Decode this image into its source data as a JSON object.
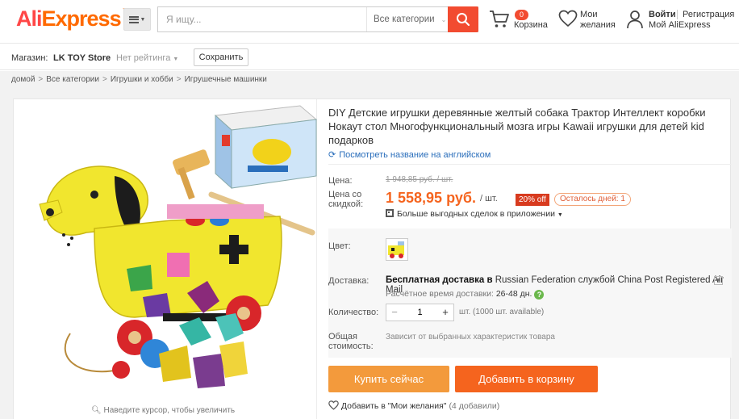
{
  "header": {
    "logo_ali": "Ali",
    "logo_express": "Express",
    "logo_tm": "™",
    "search_placeholder": "Я ищу...",
    "category_select": "Все категории",
    "cart_count": "0",
    "cart_label": "Корзина",
    "wishlist_line1": "Мои",
    "wishlist_line2": "желания",
    "signin": "Войти",
    "register": "Регистрация",
    "my_aliexpress": "Мой AliExpress",
    "colors": {
      "brand_red": "#ff4747",
      "brand_orange": "#ff6a00",
      "search_btn": "#f24b30"
    }
  },
  "store_bar": {
    "label": "Магазин:",
    "store_name": "LK TOY Store",
    "rating": "Нет рейтинга",
    "save_button": "Сохранить"
  },
  "breadcrumb": [
    "домой",
    "Все категории",
    "Игрушки и хобби",
    "Игрушечные машинки"
  ],
  "breadcrumb_sep": ">",
  "gallery": {
    "zoom_hint": "Наведите курсор, чтобы увеличить",
    "image_icon": "dog-tractor-toy-image"
  },
  "product": {
    "title": "DIY Детские игрушки деревянные желтый собака Трактор Интеллект коробки Нокаут стол Многофункциональный мозга игры Kawaii игрушки для детей kid подарков",
    "translate_link": "Посмотреть название на английском",
    "price_label": "Цена:",
    "original_price": "1 948,85 руб. / шт.",
    "discount_label_line1": "Цена со",
    "discount_label_line2": "скидкой:",
    "discount_price": "1 558,95 руб.",
    "per_unit": "/ шт.",
    "off_badge": "20% off",
    "days_left": "Осталось дней: 1",
    "app_deals": "Больше выгодных сделок в приложении",
    "color_label": "Цвет:",
    "shipping_label": "Доставка:",
    "shipping_free": "Бесплатная доставка в",
    "shipping_dest": "Russian Federation",
    "shipping_via": "службой",
    "shipping_carrier": "China Post Registered Air Mail",
    "delivery_time_label": "Расчётное время доставки:",
    "delivery_time_value": "26-48 дн.",
    "quantity_label": "Количество:",
    "quantity_value": "1",
    "quantity_note": "шт. (1000 шт. available)",
    "total_label_line1": "Общая",
    "total_label_line2": "стоимость:",
    "total_value": "Зависит от выбранных характеристик товара",
    "buy_now": "Купить сейчас",
    "add_to_cart": "Добавить в корзину",
    "add_wishlist": "Добавить в \"Мои желания\"",
    "wishlist_count": "(4 добавили)",
    "colors": {
      "price": "#f5641e",
      "buy_now": "#f39a3c",
      "add_cart": "#f5641e",
      "badge": "#d83b1f"
    }
  }
}
